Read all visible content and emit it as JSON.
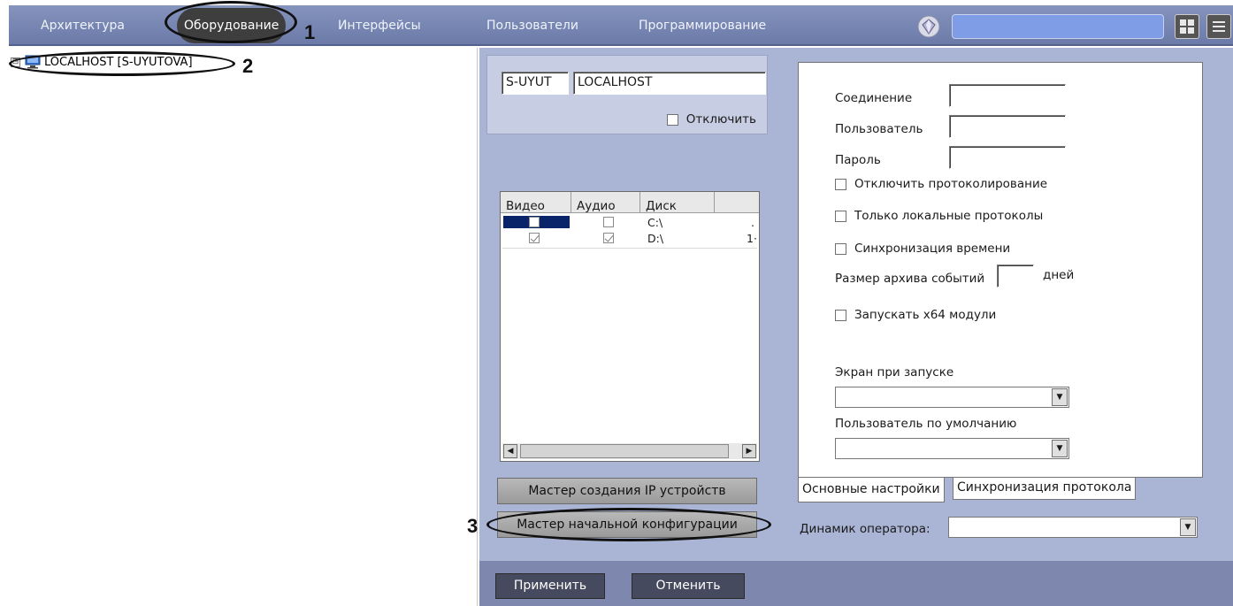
{
  "nav": {
    "tabs": [
      "Архитектура",
      "Оборудование",
      "Интерфейсы",
      "Пользователи",
      "Программирование"
    ],
    "active_tab": "Оборудование"
  },
  "annotations": [
    "1",
    "2",
    "3"
  ],
  "tree": {
    "node_label": "LOCALHOST [S-UYUTOVA]",
    "expand_glyph": "⊟",
    "node_icon": "computer-icon"
  },
  "computer": {
    "id": "S-UYUT",
    "name": "LOCALHOST",
    "disable_label": "Отключить"
  },
  "disks": {
    "headers": [
      "Видео",
      "Аудио",
      "Диск"
    ],
    "rows": [
      {
        "video": false,
        "audio": false,
        "disk": "C:\\",
        "extra": "."
      },
      {
        "video": true,
        "audio": true,
        "disk": "D:\\",
        "extra": "1·"
      }
    ]
  },
  "buttons": {
    "ip_wizard": "Мастер создания IP устройств",
    "init_wizard": "Мастер начальной конфигурации",
    "apply": "Применить",
    "cancel": "Отменить"
  },
  "settings": {
    "connection_label": "Соединение",
    "connection_value": "",
    "user_label": "Пользователь",
    "user_value": "",
    "password_label": "Пароль",
    "password_value": "",
    "disable_logging": "Отключить протоколирование",
    "local_logs_only": "Только локальные протоколы",
    "time_sync": "Синхронизация времени",
    "archive_size_label": "Размер архива событий",
    "archive_size_value": "",
    "archive_size_unit": "дней",
    "run_x64": "Запускать x64 модули",
    "startup_screen_label": "Экран при запуске",
    "startup_screen_value": "",
    "default_user_label": "Пользователь по умолчанию",
    "default_user_value": ""
  },
  "settings_tabs": [
    "Основные настройки",
    "Синхронизация протокола"
  ],
  "operator_speaker": {
    "label": "Динамик оператора:",
    "value": ""
  },
  "colors": {
    "topbar": "#7583b0",
    "main_bg": "#aab4d4",
    "selection": "#0a246a",
    "search_fill": "#7f9de6"
  }
}
